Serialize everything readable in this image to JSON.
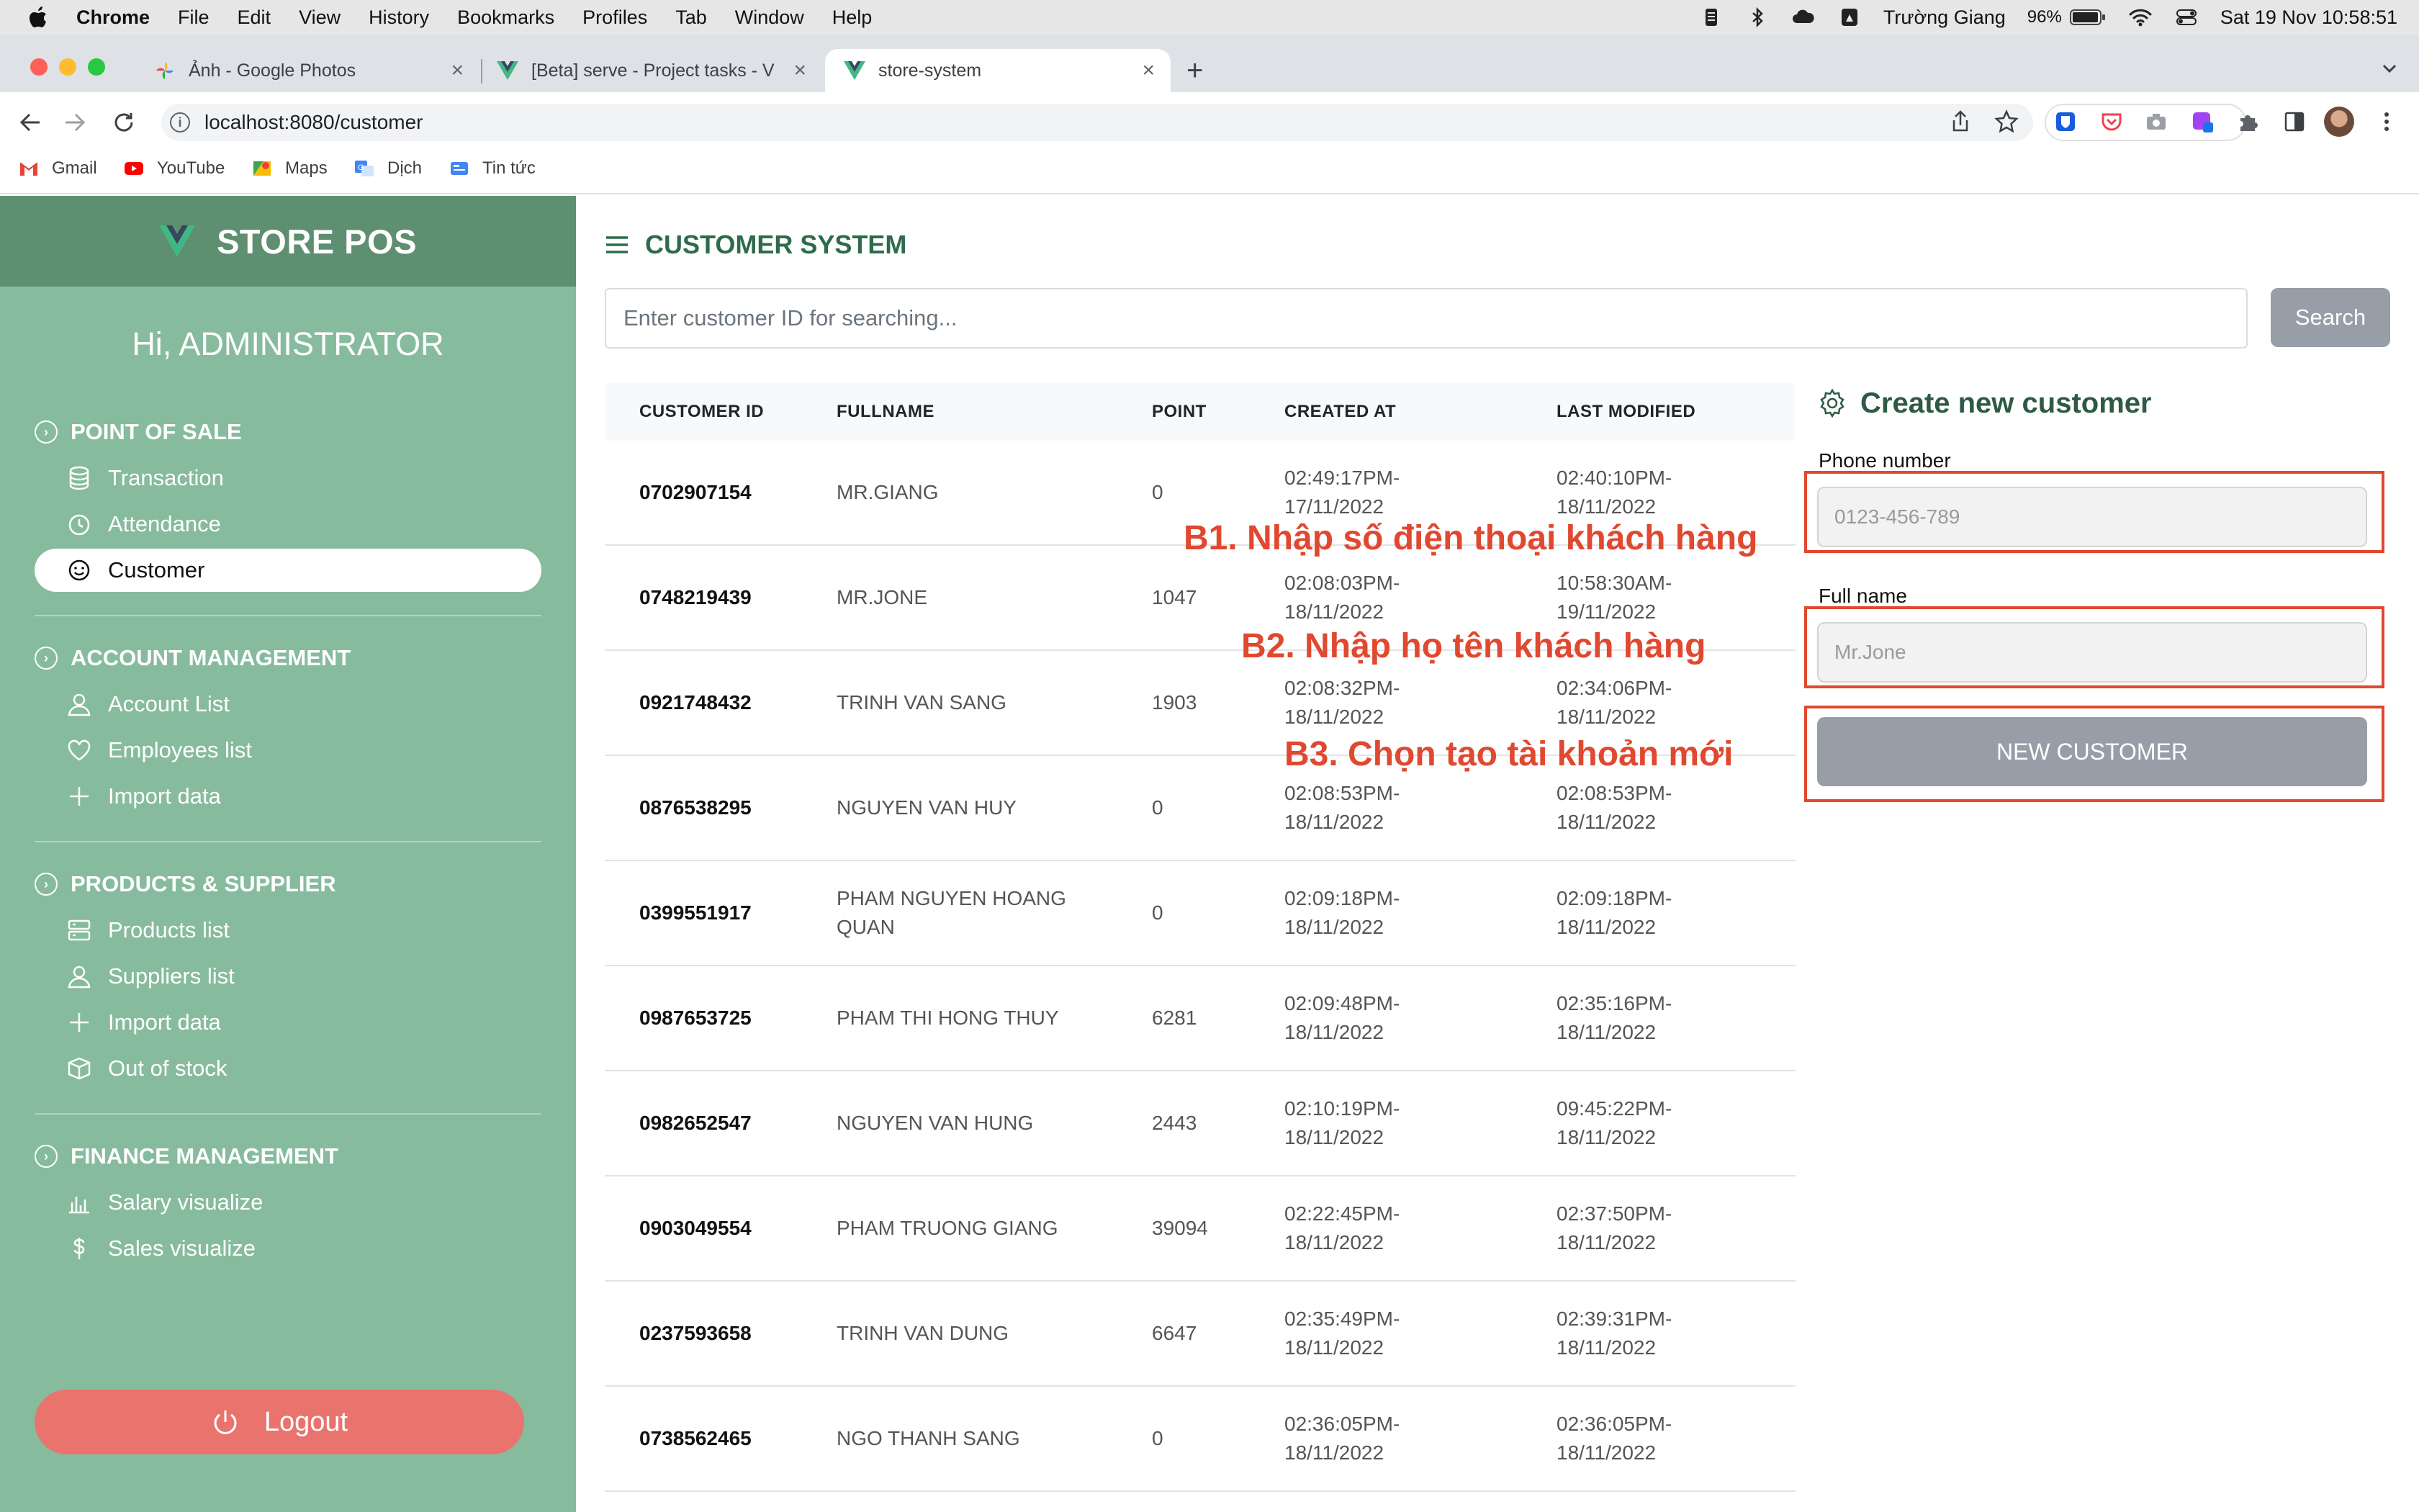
{
  "macos_menubar": {
    "app_name": "Chrome",
    "menus": [
      "File",
      "Edit",
      "View",
      "History",
      "Bookmarks",
      "Profiles",
      "Tab",
      "Window",
      "Help"
    ],
    "user_name": "Trường Giang",
    "battery": "96%",
    "datetime": "Sat 19 Nov  10:58:51"
  },
  "browser": {
    "tabs": [
      {
        "title": "Ảnh - Google Photos",
        "icon": "google-photos-icon"
      },
      {
        "title": "[Beta] serve - Project tasks - V",
        "icon": "vue-icon"
      },
      {
        "title": "store-system",
        "icon": "vue-icon",
        "active": true
      }
    ],
    "url": "localhost:8080/customer",
    "bookmarks": [
      {
        "label": "Gmail",
        "icon": "gmail-icon"
      },
      {
        "label": "YouTube",
        "icon": "youtube-icon"
      },
      {
        "label": "Maps",
        "icon": "maps-icon"
      },
      {
        "label": "Dịch",
        "icon": "translate-icon"
      },
      {
        "label": "Tin tức",
        "icon": "news-icon"
      }
    ]
  },
  "sidebar": {
    "brand": "STORE POS",
    "greeting": "Hi, ADMINISTRATOR",
    "sections": [
      {
        "title": "POINT OF SALE",
        "items": [
          {
            "label": "Transaction",
            "icon": "database-icon"
          },
          {
            "label": "Attendance",
            "icon": "clock-icon"
          },
          {
            "label": "Customer",
            "icon": "smile-icon",
            "active": true
          }
        ]
      },
      {
        "title": "ACCOUNT MANAGEMENT",
        "items": [
          {
            "label": "Account List",
            "icon": "user-icon"
          },
          {
            "label": "Employees list",
            "icon": "heart-icon"
          },
          {
            "label": "Import data",
            "icon": "plus-icon"
          }
        ]
      },
      {
        "title": "PRODUCTS & SUPPLIER",
        "items": [
          {
            "label": "Products list",
            "icon": "server-icon"
          },
          {
            "label": "Suppliers list",
            "icon": "user-icon"
          },
          {
            "label": "Import data",
            "icon": "plus-icon"
          },
          {
            "label": "Out of stock",
            "icon": "box-icon"
          }
        ]
      },
      {
        "title": "FINANCE MANAGEMENT",
        "items": [
          {
            "label": "Salary visualize",
            "icon": "bar-chart-icon"
          },
          {
            "label": "Sales visualize",
            "icon": "dollar-icon"
          }
        ]
      }
    ],
    "logout_label": "Logout"
  },
  "main": {
    "title": "CUSTOMER SYSTEM",
    "search": {
      "placeholder": "Enter customer ID for searching...",
      "button": "Search"
    },
    "table": {
      "columns": [
        "CUSTOMER ID",
        "FULLNAME",
        "POINT",
        "CREATED AT",
        "LAST MODIFIED"
      ],
      "rows": [
        {
          "id": "0702907154",
          "name": "MR.GIANG",
          "point": "0",
          "created": "02:49:17PM-17/11/2022",
          "modified": "02:40:10PM-18/11/2022"
        },
        {
          "id": "0748219439",
          "name": "MR.JONE",
          "point": "1047",
          "created": "02:08:03PM-18/11/2022",
          "modified": "10:58:30AM-19/11/2022"
        },
        {
          "id": "0921748432",
          "name": "TRINH VAN SANG",
          "point": "1903",
          "created": "02:08:32PM-18/11/2022",
          "modified": "02:34:06PM-18/11/2022"
        },
        {
          "id": "0876538295",
          "name": "NGUYEN VAN HUY",
          "point": "0",
          "created": "02:08:53PM-18/11/2022",
          "modified": "02:08:53PM-18/11/2022"
        },
        {
          "id": "0399551917",
          "name": "PHAM NGUYEN HOANG QUAN",
          "point": "0",
          "created": "02:09:18PM-18/11/2022",
          "modified": "02:09:18PM-18/11/2022"
        },
        {
          "id": "0987653725",
          "name": "PHAM THI HONG THUY",
          "point": "6281",
          "created": "02:09:48PM-18/11/2022",
          "modified": "02:35:16PM-18/11/2022"
        },
        {
          "id": "0982652547",
          "name": "NGUYEN VAN HUNG",
          "point": "2443",
          "created": "02:10:19PM-18/11/2022",
          "modified": "09:45:22PM-18/11/2022"
        },
        {
          "id": "0903049554",
          "name": "PHAM TRUONG GIANG",
          "point": "39094",
          "created": "02:22:45PM-18/11/2022",
          "modified": "02:37:50PM-18/11/2022"
        },
        {
          "id": "0237593658",
          "name": "TRINH VAN DUNG",
          "point": "6647",
          "created": "02:35:49PM-18/11/2022",
          "modified": "02:39:31PM-18/11/2022"
        },
        {
          "id": "0738562465",
          "name": "NGO THANH SANG",
          "point": "0",
          "created": "02:36:05PM-18/11/2022",
          "modified": "02:36:05PM-18/11/2022"
        }
      ]
    }
  },
  "create_form": {
    "title": "Create new customer",
    "phone_label": "Phone number",
    "phone_placeholder": "0123-456-789",
    "name_label": "Full name",
    "name_placeholder": "Mr.Jone",
    "submit": "NEW CUSTOMER"
  },
  "annotations": {
    "step1": "B1. Nhập số điện thoại khách hàng",
    "step2": "B2. Nhập họ tên khách hàng",
    "step3": "B3. Chọn tạo tài khoản mới"
  },
  "colors": {
    "sidebar_bg": "#87bb9e",
    "brand_bg": "#5d8f70",
    "accent_text": "#2e6b4b",
    "logout": "#e9746d",
    "annotation_red": "#e0482f",
    "button_gray": "#989ea7"
  }
}
